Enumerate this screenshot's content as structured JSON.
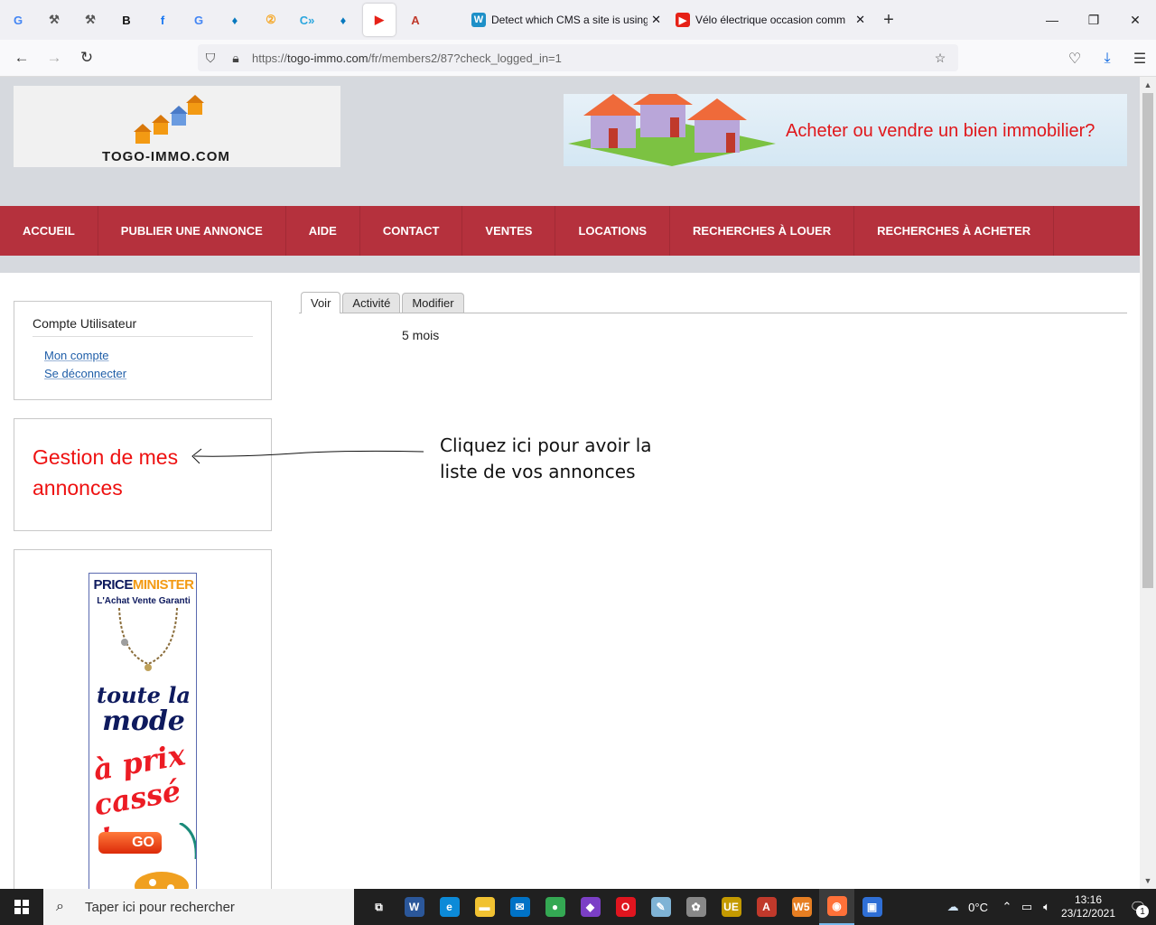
{
  "browser": {
    "pinned_tabs": [
      {
        "icon": "google-icon",
        "glyph": "G",
        "color": "#4285f4"
      },
      {
        "icon": "bookmark-tool-icon",
        "glyph": "⚒",
        "color": "#555555"
      },
      {
        "icon": "bookmark-tool-icon",
        "glyph": "⚒",
        "color": "#555555"
      },
      {
        "icon": "b-logo-icon",
        "glyph": "B",
        "color": "#111111"
      },
      {
        "icon": "facebook-icon",
        "glyph": "f",
        "color": "#1877f2"
      },
      {
        "icon": "google-icon",
        "glyph": "G",
        "color": "#4285f4"
      },
      {
        "icon": "drupal-icon",
        "glyph": "♦",
        "color": "#0678be"
      },
      {
        "icon": "orange-badge-icon",
        "glyph": "②",
        "color": "#f5a623"
      },
      {
        "icon": "ci-icon",
        "glyph": "C»",
        "color": "#2aa6de"
      },
      {
        "icon": "drupal-icon",
        "glyph": "♦",
        "color": "#0678be"
      },
      {
        "icon": "youtube-icon",
        "glyph": "▶",
        "color": "#e62117"
      },
      {
        "icon": "adobe-text-icon",
        "glyph": "A",
        "color": "#c0392b"
      }
    ],
    "tabs": [
      {
        "label": "Detect which CMS a site is using",
        "icon_glyph": "W",
        "icon_color": "#1e90c8"
      },
      {
        "label": "Vélo électrique occasion comm",
        "icon_glyph": "▶",
        "icon_color": "#e62117"
      }
    ],
    "url_prefix": "https://",
    "url_host": "togo-immo.com",
    "url_path": "/fr/members2/87?check_logged_in=1"
  },
  "site": {
    "logo_text": "TOGO-IMMO.COM",
    "banner_text": "Acheter ou vendre un bien immobilier?",
    "nav": [
      "ACCUEIL",
      "PUBLIER UNE ANNONCE",
      "AIDE",
      "CONTACT",
      "VENTES",
      "LOCATIONS",
      "RECHERCHES À LOUER",
      "RECHERCHES À ACHETER"
    ],
    "user_block": {
      "title": "Compte Utilisateur",
      "links": [
        "Mon compte",
        "Se déconnecter"
      ]
    },
    "gestion_link": "Gestion de mes annonces",
    "tabs": [
      "Voir",
      "Activité",
      "Modifier"
    ],
    "active_tab": "Voir",
    "member_for": "5 mois",
    "annotation": [
      "Cliquez ici pour avoir la",
      "liste de vos annonces"
    ],
    "ad": {
      "brand_a": "PRICE",
      "brand_b": "MINISTER",
      "slogan": "L'Achat Vente Garanti",
      "line1": "toute la",
      "line2": "mode",
      "line3": "à prix",
      "line4": "cassé !",
      "button": "GO"
    }
  },
  "taskbar": {
    "search_placeholder": "Taper ici pour rechercher",
    "temperature": "0°C",
    "time": "13:16",
    "date": "23/12/2021",
    "notifications": "1",
    "apps": [
      {
        "icon": "task-view-icon",
        "glyph": "⧉",
        "color": "#202020"
      },
      {
        "icon": "word-icon",
        "glyph": "W",
        "color": "#2b579a"
      },
      {
        "icon": "edge-icon",
        "glyph": "e",
        "color": "#0c8ad8"
      },
      {
        "icon": "file-explorer-icon",
        "glyph": "▬",
        "color": "#f1c232"
      },
      {
        "icon": "outlook-icon",
        "glyph": "✉",
        "color": "#0072c6"
      },
      {
        "icon": "chrome-icon",
        "glyph": "●",
        "color": "#34a853"
      },
      {
        "icon": "brave-icon",
        "glyph": "◆",
        "color": "#7b3fc6"
      },
      {
        "icon": "opera-icon",
        "glyph": "O",
        "color": "#e0151f"
      },
      {
        "icon": "notepad-icon",
        "glyph": "✎",
        "color": "#7fb3d5"
      },
      {
        "icon": "paint-icon",
        "glyph": "✿",
        "color": "#888888"
      },
      {
        "icon": "ue-icon",
        "glyph": "UE",
        "color": "#c49a00"
      },
      {
        "icon": "acrobat-icon",
        "glyph": "A",
        "color": "#c0392b"
      },
      {
        "icon": "ws-icon",
        "glyph": "W5",
        "color": "#e67e22"
      },
      {
        "icon": "firefox-icon",
        "glyph": "◉",
        "color": "#ff7139"
      },
      {
        "icon": "network-app-icon",
        "glyph": "▣",
        "color": "#2f6fd6"
      }
    ]
  }
}
